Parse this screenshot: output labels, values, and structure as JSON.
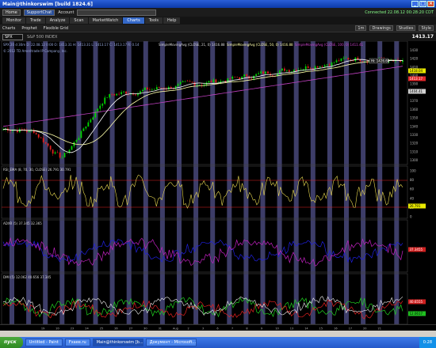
{
  "window": {
    "title": "Main@thinkorswim [build 1824.6]",
    "buttons": [
      "_",
      "□",
      "×"
    ]
  },
  "topbar": {
    "home": "Home",
    "support": "SupportChat",
    "account_label": "Account",
    "connected": "Connected 22.08.12 00:28:20 CDT"
  },
  "tabs": [
    {
      "label": "Monitor",
      "active": false
    },
    {
      "label": "Trade",
      "active": false
    },
    {
      "label": "Analyze",
      "active": false
    },
    {
      "label": "Scan",
      "active": false
    },
    {
      "label": "MarketWatch",
      "active": false
    },
    {
      "label": "Charts",
      "active": true
    },
    {
      "label": "Tools",
      "active": false
    },
    {
      "label": "Help",
      "active": false
    }
  ],
  "subtabs": {
    "charts": "Charts",
    "prophet": "Prophet",
    "flexible_grid": "Flexible Grid",
    "timeframe": "1m",
    "drawings": "Drawings",
    "studies": "Studies",
    "style": "Style"
  },
  "symbar": {
    "symbol": "SPX",
    "description": "S&P 500 INDEX",
    "price": "1413.17"
  },
  "price_pane": {
    "header": "SPX 20 d 30m  D: 22.08.12 0:00   O: 1413.31   H: 1413.31   L: 1413.17   C: 1413.17   R: 0.14",
    "sma21": "SimpleMovingAvg (CLOSE, 21, 0)  1416.88",
    "sma50": "SimpleMovingAvg (CLOSE, 50, 0)  1416.88",
    "sma100": "SimpleMovingAvg (CLOSE, 100, 0)  1411.41",
    "copyright": "© 2012 TD Ameritrade IP Company, Inc.",
    "hi_label": "Hi: 1426.68",
    "axis_ticks": [
      "1430",
      "1420",
      "1410",
      "1400",
      "1390",
      "1380",
      "1370",
      "1360",
      "1350",
      "1340",
      "1330",
      "1320",
      "1310",
      "1300"
    ],
    "price_flags": [
      {
        "text": "1418.04",
        "color": "#e8e800"
      },
      {
        "text": "1413.17",
        "color": "#e0262a"
      },
      {
        "text": "1404.41",
        "color": "#d2d2d2"
      }
    ]
  },
  "rsi_pane": {
    "header": "RSI_EMA (8, 70, 30, CLOSE)  26.791  30.791",
    "axis_ticks": [
      "100",
      "80",
      "60",
      "40",
      "20",
      "0"
    ],
    "flag": "26.791"
  },
  "adx_pane": {
    "header": "ADXR (5)  37.345  32.365",
    "flag": "37.3455"
  },
  "dmi_pane": {
    "header": "DMI (5)  12.062  40.656  37.345",
    "flag_top": "40.6555",
    "flag_bottom": "12.0617"
  },
  "x_axis": [
    "19",
    "20",
    "23",
    "24",
    "25",
    "26",
    "27",
    "30",
    "31",
    "Aug",
    "2",
    "3",
    "6",
    "7",
    "8",
    "9",
    "10",
    "13",
    "14",
    "15",
    "16",
    "17",
    "20",
    "21"
  ],
  "taskbar": {
    "start": "пуск",
    "items": [
      "Untitled - Paint",
      "Fxaee.ru",
      "Main@thinkorswim [b...",
      "Документ - Microsoft..."
    ],
    "active_index": 2,
    "clock": "0:28"
  },
  "colors": {
    "up_candle": "#00d400",
    "down_candle": "#e01e1e",
    "sma21": "#ffffff",
    "sma50": "#ffffaa",
    "sma100": "#c040c0",
    "rsi": "#e8d850",
    "adx_main": "#c020c0",
    "adx_sig": "#2020e0",
    "dmi_plus": "#20d020",
    "dmi_minus": "#e02020",
    "dmi_adx": "#f0f0f0",
    "night_band": "#3d3d68"
  }
}
